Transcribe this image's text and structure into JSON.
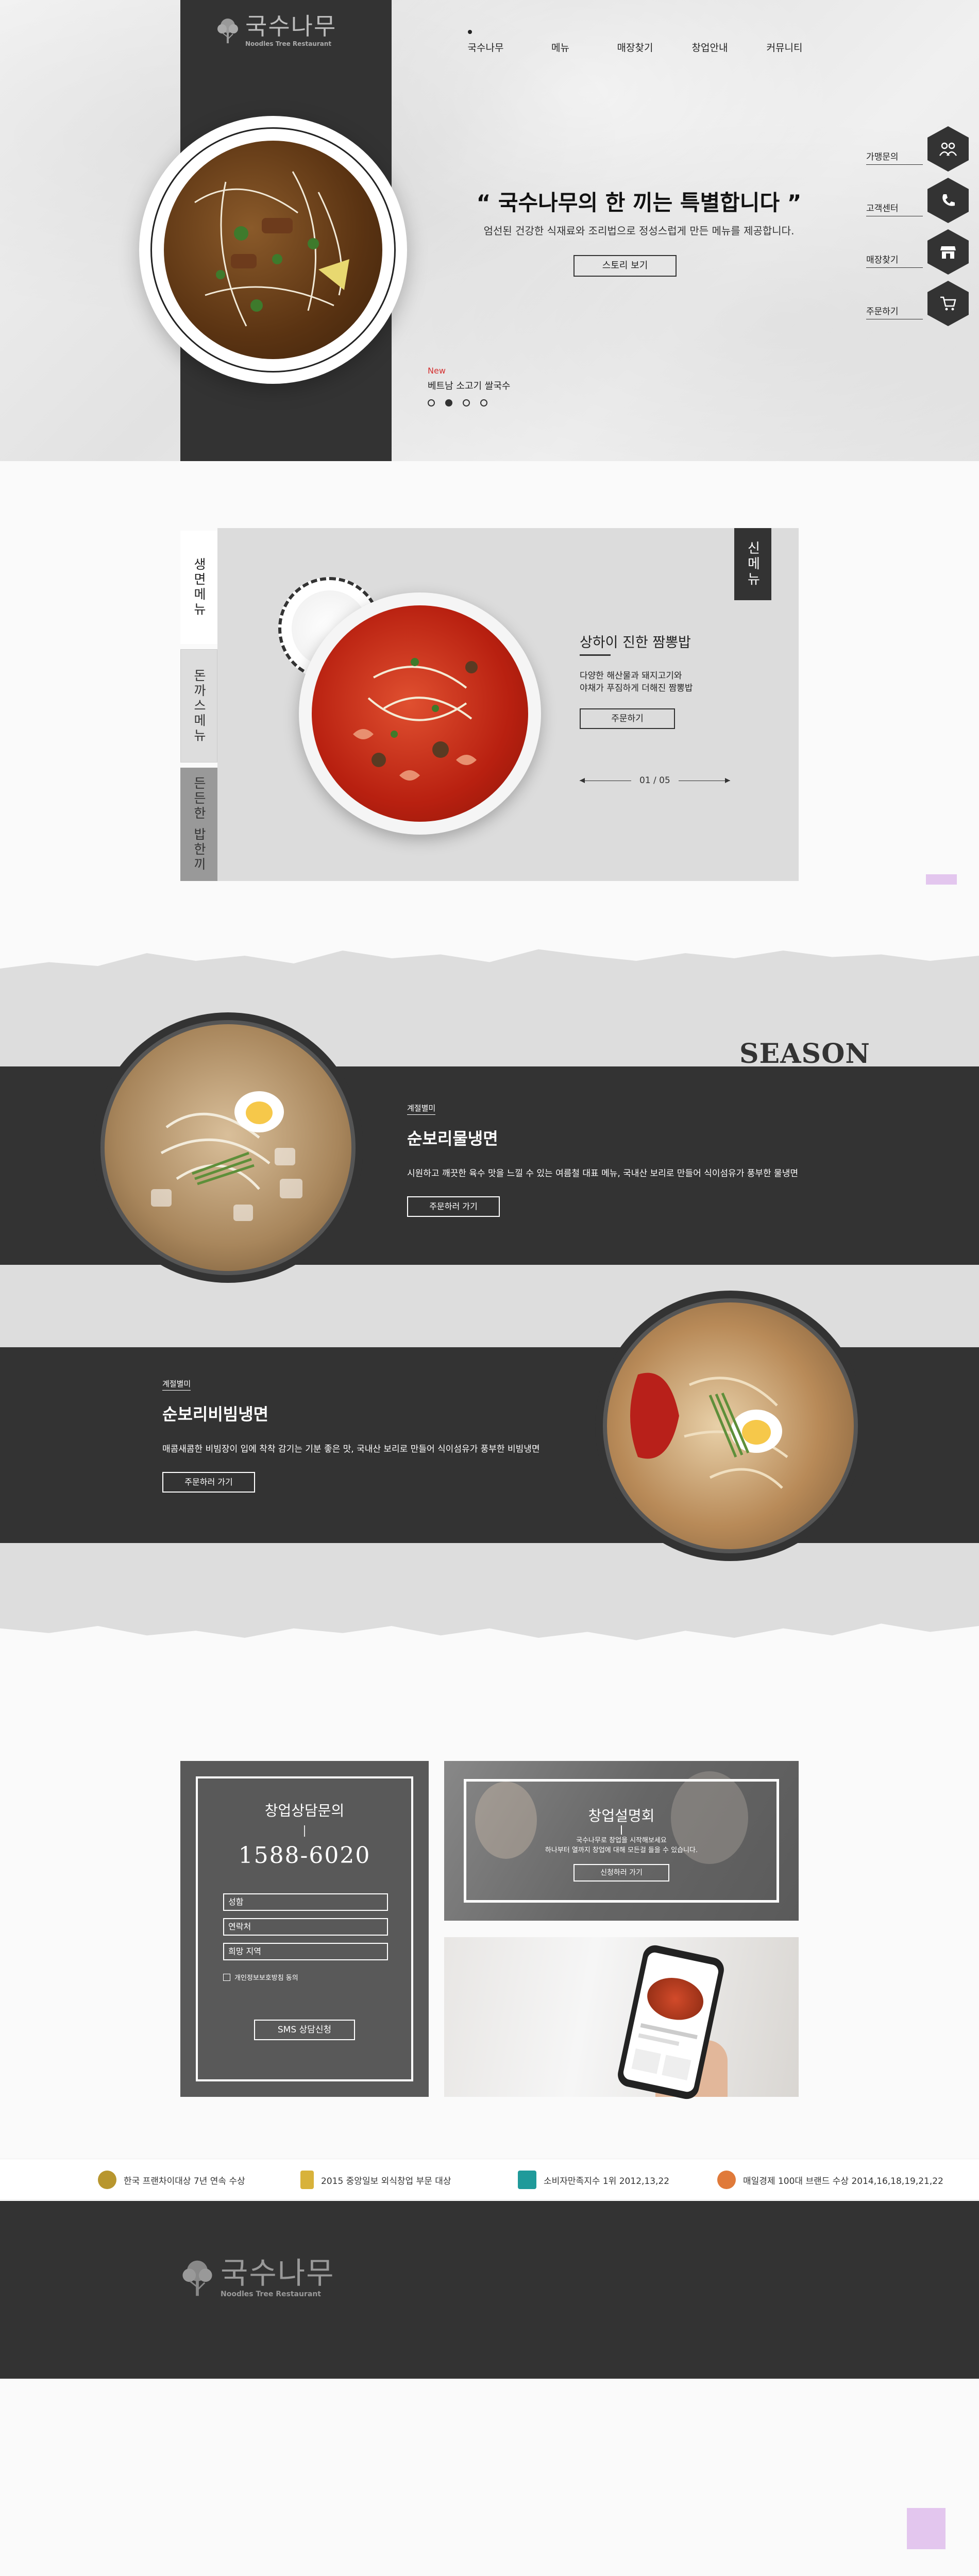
{
  "brand": {
    "name_kr": "국수나무",
    "name_en": "Noodles Tree Restaurant"
  },
  "nav": {
    "items": [
      "국수나무",
      "메뉴",
      "매장찾기",
      "창업안내",
      "커뮤니티"
    ],
    "active_index": 0
  },
  "hero": {
    "title": "“ 국수나무의 한 끼는 특별합니다 ”",
    "subtitle": "엄선된 건강한 식재료와 조리법으로 정성스럽게 만든 메뉴를 제공합니다.",
    "story_button": "스토리 보기",
    "new_label": "New",
    "new_text": "베트남 소고기 쌀국수",
    "slide_count": 4,
    "active_slide": 1
  },
  "quick_menu": [
    {
      "label": "가맹문의",
      "icon": "people-icon"
    },
    {
      "label": "고객센터",
      "icon": "phone-icon"
    },
    {
      "label": "매장찾기",
      "icon": "store-icon"
    },
    {
      "label": "주문하기",
      "icon": "cart-icon"
    }
  ],
  "menu_section": {
    "tabs": [
      "생면메뉴",
      "돈까스메뉴",
      "든든한 밥한끼"
    ],
    "active_tab": 0,
    "badge": "신메뉴",
    "item_title": "상하이 진한 짬뽕밥",
    "item_desc_1": "다양한 해산물과 돼지고기와",
    "item_desc_2": "야채가 푸짐하게 더해진 짬뽕밥",
    "order_button": "주문하기",
    "pager": "01 / 05"
  },
  "season": {
    "title": "SEASON MENU",
    "items": [
      {
        "tag": "계절별미",
        "title": "순보리물냉면",
        "desc": "시원하고 깨끗한 육수 맛을 느낄 수 있는 여름철 대표 메뉴, 국내산 보리로 만들어 식이섬유가 풍부한 물냉면",
        "button": "주문하러 가기"
      },
      {
        "tag": "계절별미",
        "title": "순보리비빔냉면",
        "desc": "매콤새콤한 비빔장이 입에 착착 감기는 기분 좋은 맛, 국내산 보리로 만들어 식이섬유가 풍부한 비빔냉면",
        "button": "주문하러 가기"
      }
    ]
  },
  "franchise": {
    "title": "창업상담문의",
    "phone": "1588-6020",
    "fields": [
      "성함",
      "연락처",
      "희망 지역"
    ],
    "privacy": "개인정보보호방침 동의",
    "sms_button": "SMS 상담신청",
    "briefing_title": "창업설명회",
    "briefing_desc_1": "국수나무로 창업을 시작해보세요",
    "briefing_desc_2": "하나부터 열까지 창업에 대해 모든걸 들을 수 있습니다.",
    "briefing_button": "신청하러 가기"
  },
  "awards": [
    "한국 프랜차이대상 7년 연속 수상",
    "2015 중앙일보 외식창업 부문 대상",
    "소비자만족지수 1위 2012,13,22",
    "매일경제 100대 브랜드 수상 2014,16,18,19,21,22"
  ],
  "colors": {
    "dark": "#333333",
    "panel": "#dcdcdc",
    "accent_new": "#d43030"
  }
}
